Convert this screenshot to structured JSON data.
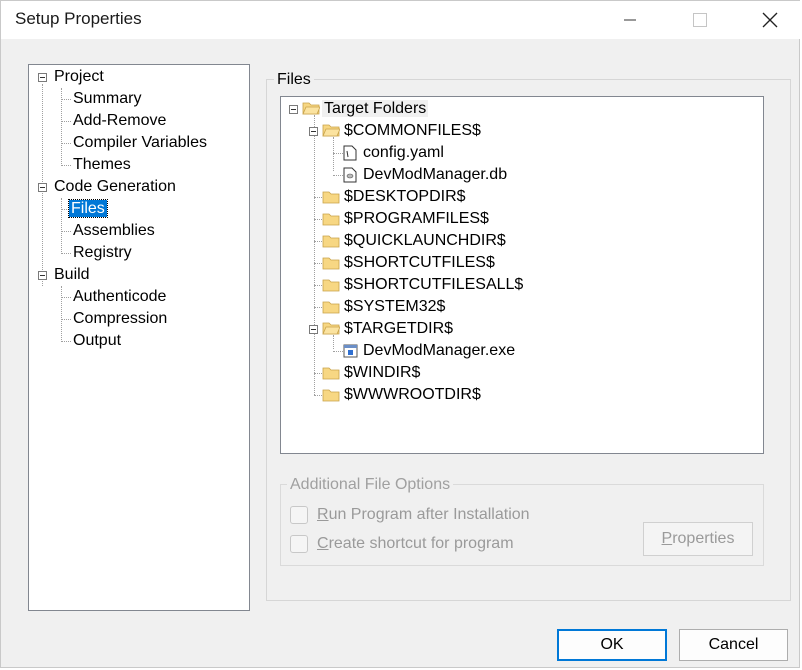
{
  "window": {
    "title": "Setup Properties"
  },
  "left_tree": {
    "nodes": [
      {
        "label": "Project",
        "level": 0,
        "expanded": true
      },
      {
        "label": "Summary",
        "level": 1
      },
      {
        "label": "Add-Remove",
        "level": 1
      },
      {
        "label": "Compiler Variables",
        "level": 1
      },
      {
        "label": "Themes",
        "level": 1
      },
      {
        "label": "Code Generation",
        "level": 0,
        "expanded": true
      },
      {
        "label": "Files",
        "level": 1,
        "selected": true
      },
      {
        "label": "Assemblies",
        "level": 1
      },
      {
        "label": "Registry",
        "level": 1
      },
      {
        "label": "Build",
        "level": 0,
        "expanded": true
      },
      {
        "label": "Authenticode",
        "level": 1
      },
      {
        "label": "Compression",
        "level": 1
      },
      {
        "label": "Output",
        "level": 1
      }
    ]
  },
  "files_group": {
    "caption": "Files",
    "tree": [
      {
        "label": "Target Folders",
        "icon": "folder-open-icon"
      },
      {
        "label": "$COMMONFILES$",
        "icon": "folder-open-icon"
      },
      {
        "label": "config.yaml",
        "icon": "file-icon"
      },
      {
        "label": "DevModManager.db",
        "icon": "database-file-icon"
      },
      {
        "label": "$DESKTOPDIR$",
        "icon": "folder-icon"
      },
      {
        "label": "$PROGRAMFILES$",
        "icon": "folder-icon"
      },
      {
        "label": "$QUICKLAUNCHDIR$",
        "icon": "folder-icon"
      },
      {
        "label": "$SHORTCUTFILES$",
        "icon": "folder-icon"
      },
      {
        "label": "$SHORTCUTFILESALL$",
        "icon": "folder-icon"
      },
      {
        "label": "$SYSTEM32$",
        "icon": "folder-icon"
      },
      {
        "label": "$TARGETDIR$",
        "icon": "folder-open-icon"
      },
      {
        "label": "DevModManager.exe",
        "icon": "exe-file-icon"
      },
      {
        "label": "$WINDIR$",
        "icon": "folder-icon"
      },
      {
        "label": "$WWWROOTDIR$",
        "icon": "folder-icon"
      }
    ]
  },
  "additional_options": {
    "caption": "Additional File Options",
    "run_program_prefix": "R",
    "run_program_rest": "un Program after Installation",
    "create_shortcut_prefix": "C",
    "create_shortcut_rest": "reate shortcut for program",
    "properties_prefix": "P",
    "properties_rest": "roperties"
  },
  "buttons": {
    "ok": "OK",
    "cancel": "Cancel"
  },
  "colors": {
    "selection": "#0078d7",
    "folder": "#f7d783",
    "dialog_bg": "#f0f0f0"
  }
}
